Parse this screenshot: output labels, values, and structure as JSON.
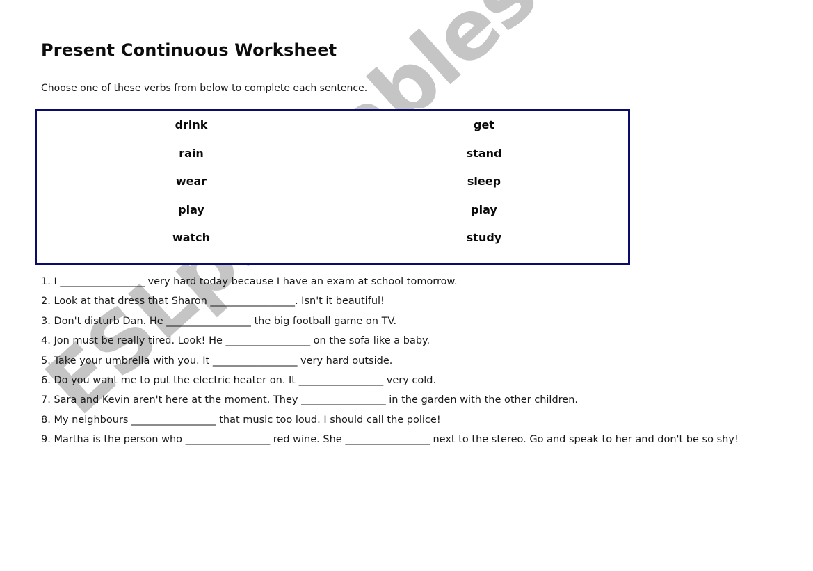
{
  "title": "Present Continuous Worksheet",
  "instructions": "Choose one of these verbs from below to complete each sentence.",
  "verb_box": {
    "left_column": [
      "drink",
      "rain",
      "wear",
      "play",
      "watch"
    ],
    "right_column": [
      "get",
      "stand",
      "sleep",
      "play",
      "study"
    ]
  },
  "sentences": [
    {
      "parts": [
        "1. I ",
        "_________________",
        " very hard today because I have an exam at school tomorrow."
      ]
    },
    {
      "parts": [
        "2. Look at that dress that Sharon ",
        "_________________",
        ". Isn't it beautiful!"
      ]
    },
    {
      "parts": [
        "3. Don't disturb Dan. He ",
        "_________________",
        " the big football game on TV."
      ]
    },
    {
      "parts": [
        "4. Jon must be really tired. Look! He ",
        "_________________",
        " on the sofa like a baby."
      ]
    },
    {
      "parts": [
        "5. Take your umbrella with you. It ",
        "_________________",
        " very hard outside."
      ]
    },
    {
      "parts": [
        "6. Do you want me to put the electric heater on. It ",
        "_________________",
        " very cold."
      ]
    },
    {
      "parts": [
        "7. Sara and Kevin aren't here at the moment. They ",
        "_________________",
        " in the garden with the other children."
      ]
    },
    {
      "parts": [
        "8. My neighbours ",
        "_________________",
        " that music too loud. I should call the police!"
      ]
    },
    {
      "parts": [
        "9. Martha is the person who ",
        "_________________",
        " red wine. She ",
        "_________________",
        " next to the stereo. Go and speak to her and don't be so shy!"
      ]
    }
  ],
  "watermark": "ESLprintables.com",
  "colors": {
    "box_border": "#0b0b6b",
    "watermark": "#a0a0a0"
  }
}
